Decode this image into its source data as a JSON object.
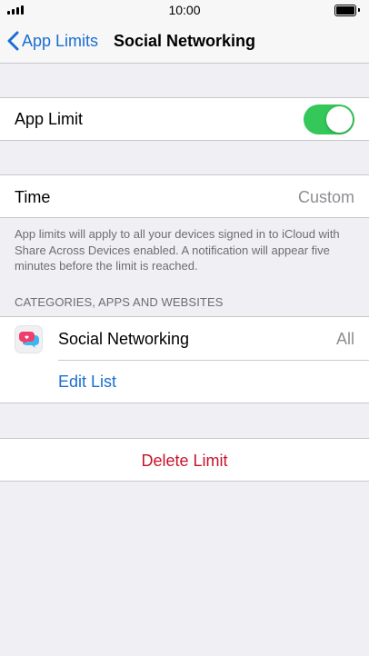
{
  "status_bar": {
    "time": "10:00"
  },
  "nav": {
    "back_label": "App Limits",
    "title": "Social Networking"
  },
  "app_limit": {
    "label": "App Limit",
    "enabled": true
  },
  "time_row": {
    "label": "Time",
    "value": "Custom"
  },
  "footnote": "App limits will apply to all your devices signed in to iCloud with Share Across Devices enabled. A notification will appear five minutes before the limit is reached.",
  "categories": {
    "header": "CATEGORIES, APPS AND WEBSITES",
    "items": [
      {
        "name": "Social Networking",
        "value": "All",
        "icon": "social-networking-icon"
      }
    ],
    "edit_label": "Edit List"
  },
  "delete_label": "Delete Limit",
  "colors": {
    "accent": "#1a6fd1",
    "toggle_on": "#34c759",
    "destructive": "#c8142a",
    "background": "#efeff4"
  }
}
